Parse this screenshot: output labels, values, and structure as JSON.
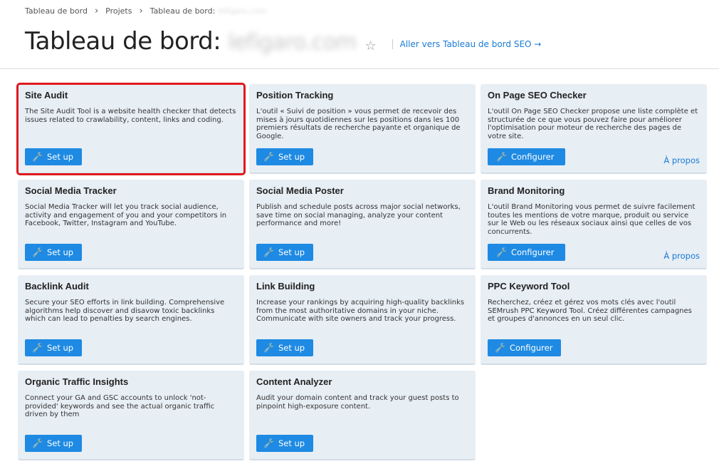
{
  "breadcrumb": {
    "items": [
      "Tableau de bord",
      "Projets",
      "Tableau de bord:"
    ],
    "separator": "›",
    "blurred_domain": "lefigaro.com"
  },
  "header": {
    "title": "Tableau de bord:",
    "domain": "lefigaro.com",
    "seo_link": "Aller vers Tableau de bord SEO →"
  },
  "colors": {
    "accent": "#1e8ae3",
    "card_bg": "#e7eef4",
    "highlight": "#e0191e"
  },
  "cards": [
    {
      "title": "Site Audit",
      "desc": "The Site Audit Tool is a website health checker that detects issues related to crawlability, content, links and coding.",
      "button": "Set up"
    },
    {
      "title": "Position Tracking",
      "desc": "L'outil « Suivi de position » vous permet de recevoir des mises à jours quotidiennes sur les positions dans les 100 premiers résultats de recherche payante et organique de Google.",
      "button": "Set up"
    },
    {
      "title": "On Page SEO Checker",
      "desc": "L'outil On Page SEO Checker propose une liste complète et structurée de ce que vous pouvez faire pour améliorer l'optimisation pour moteur de recherche des pages de votre site.",
      "button": "Configurer",
      "link": "À propos"
    },
    {
      "title": "Social Media Tracker",
      "desc": "Social Media Tracker will let you track social audience, activity and engagement of you and your competitors in Facebook, Twitter, Instagram and YouTube.",
      "button": "Set up"
    },
    {
      "title": "Social Media Poster",
      "desc": "Publish and schedule posts across major social networks, save time on social managing, analyze your content performance and more!",
      "button": "Set up"
    },
    {
      "title": "Brand Monitoring",
      "desc": "L'outil Brand Monitoring vous permet de suivre facilement toutes les mentions de votre marque, produit ou service sur le Web ou les réseaux sociaux ainsi que celles de vos concurrents.",
      "button": "Configurer",
      "link": "À propos"
    },
    {
      "title": "Backlink Audit",
      "desc": "Secure your SEO efforts in link building. Comprehensive algorithms help discover and disavow toxic backlinks which can lead to penalties by search engines.",
      "button": "Set up"
    },
    {
      "title": "Link Building",
      "desc": "Increase your rankings by acquiring high-quality backlinks from the most authoritative domains in your niche. Communicate with site owners and track your progress.",
      "button": "Set up"
    },
    {
      "title": "PPC Keyword Tool",
      "desc": "Recherchez, créez et gérez vos mots clés avec l'outil SEMrush PPC Keyword Tool. Créez différentes campagnes et groupes d'annonces en un seul clic.",
      "button": "Configurer"
    },
    {
      "title": "Organic Traffic Insights",
      "desc": "Connect your GA and GSC accounts to unlock 'not-provided' keywords and see the actual organic traffic driven by them",
      "button": "Set up"
    },
    {
      "title": "Content Analyzer",
      "desc": "Audit your domain content and track your guest posts to pinpoint high-exposure content.",
      "button": "Set up"
    }
  ]
}
